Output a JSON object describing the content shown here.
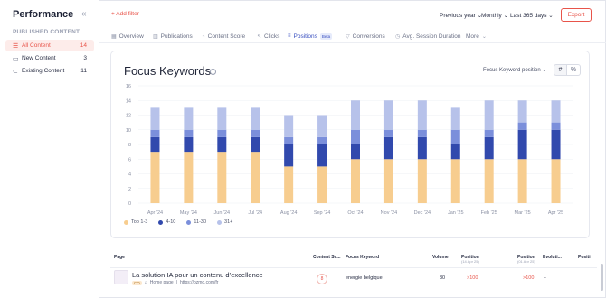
{
  "sidebar": {
    "title": "Performance",
    "collapse_icon": "double-chevron-left-icon",
    "section_label": "PUBLISHED CONTENT",
    "items": [
      {
        "label": "All Content",
        "count": "14",
        "icon": "list-icon"
      },
      {
        "label": "New Content",
        "count": "3",
        "icon": "document-icon"
      },
      {
        "label": "Existing Content",
        "count": "11",
        "icon": "link-icon"
      }
    ]
  },
  "topbar": {
    "add_filter": "+ Add filter",
    "period": "Previous year",
    "granularity": "Monthly",
    "range": "Last 365 days",
    "export": "Export"
  },
  "tabs": [
    {
      "label": "Overview"
    },
    {
      "label": "Publications"
    },
    {
      "label": "Content Score"
    },
    {
      "label": "Clicks"
    },
    {
      "label": "Positions",
      "badge": "Beta"
    },
    {
      "label": "Conversions"
    },
    {
      "label": "Avg. Session Duration"
    },
    {
      "label": "More"
    }
  ],
  "card": {
    "title": "Focus Keywords",
    "select_label": "Focus Keyword position",
    "toggle_hash": "#",
    "toggle_pct": "%"
  },
  "chart_data": {
    "type": "bar",
    "stacked": true,
    "categories": [
      "Apr '24",
      "May '24",
      "Jun '24",
      "Jul '24",
      "Aug '24",
      "Sep '24",
      "Oct '24",
      "Nov '24",
      "Dec '24",
      "Jan '25",
      "Feb '25",
      "Mar '25",
      "Apr '25"
    ],
    "ylim": [
      0,
      16
    ],
    "yticks": [
      0,
      2,
      4,
      6,
      8,
      10,
      12,
      14,
      16
    ],
    "grid": true,
    "legend_position": "bottom-left",
    "series": [
      {
        "name": "Top 1-3",
        "color": "#f7cd8f",
        "values": [
          7,
          7,
          7,
          7,
          5,
          5,
          6,
          6,
          6,
          6,
          6,
          6,
          6
        ]
      },
      {
        "name": "4-10",
        "color": "#3149ad",
        "values": [
          2,
          2,
          2,
          2,
          3,
          3,
          2,
          3,
          3,
          2,
          3,
          4,
          4
        ]
      },
      {
        "name": "11-30",
        "color": "#7b8fdb",
        "values": [
          1,
          1,
          1,
          1,
          1,
          1,
          2,
          1,
          1,
          2,
          1,
          1,
          1
        ]
      },
      {
        "name": "31+",
        "color": "#b7c2ea",
        "values": [
          3,
          3,
          3,
          3,
          3,
          3,
          4,
          4,
          4,
          3,
          4,
          3,
          3
        ]
      }
    ]
  },
  "table": {
    "headers": {
      "page": "Page",
      "content_score": "Content Sc...",
      "focus_keyword": "Focus Keyword",
      "volume": "Volume",
      "position1": "Position",
      "position1_sub": "(14 Apr 25)",
      "position2": "Position",
      "position2_sub": "(01 Apr 25)",
      "evolution": "Evoluti...",
      "position3": "Positi"
    },
    "row": {
      "title": "La solution IA pour un contenu d’excellence",
      "tag": "CO",
      "type": "Home page",
      "url": "https://ozmo.com/fr",
      "content_score": "8",
      "focus_keyword": "energie belgique",
      "volume": "30",
      "position1": ">100",
      "position2": ">100",
      "evolution": "-"
    }
  }
}
